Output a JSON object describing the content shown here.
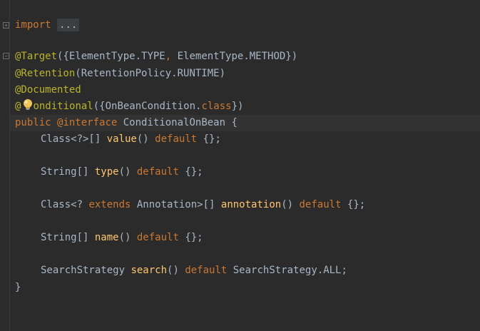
{
  "editor": {
    "lines": {
      "l1_kw": "import",
      "l1_folded": "...",
      "l2_ann": "@Target",
      "l2_rest_open": "({ElementType.TYPE",
      "l2_comma": ",",
      "l2_rest_close": " ElementType.METHOD})",
      "l3_ann": "@Retention",
      "l3_rest": "(RetentionPolicy.RUNTIME)",
      "l4_ann": "@Documented",
      "l5_ann_a": "@",
      "l5_ann_b": "onditional",
      "l5_rest_open": "({OnBeanCondition.",
      "l5_kw": "class",
      "l5_rest_close": "})",
      "l6_kw1": "public",
      "l6_kw2": "@interface",
      "l6_name": "ConditionalOnBean",
      "l6_brace": "{",
      "l7_type": "Class<?>[] ",
      "l7_method": "value",
      "l7_parens": "() ",
      "l7_kw": "default",
      "l7_tail": " {};",
      "l8_type": "String[] ",
      "l8_method": "type",
      "l8_parens": "() ",
      "l8_kw": "default",
      "l8_tail": " {};",
      "l9_type_a": "Class<? ",
      "l9_kw_ext": "extends",
      "l9_type_b": " Annotation>[] ",
      "l9_method": "annotation",
      "l9_parens": "() ",
      "l9_kw": "default",
      "l9_tail": " {};",
      "l10_type": "String[] ",
      "l10_method": "name",
      "l10_parens": "() ",
      "l10_kw": "default",
      "l10_tail": " {};",
      "l11_type": "SearchStrategy ",
      "l11_method": "search",
      "l11_parens": "() ",
      "l11_kw": "default",
      "l11_tail": " SearchStrategy.ALL;",
      "l12_brace": "}"
    },
    "colors": {
      "background": "#2b2b2b",
      "keyword": "#cc7832",
      "annotation": "#bbb529",
      "text": "#a9b7c6",
      "current_line": "#323232"
    },
    "icons": {
      "fold_expand": "plus-fold-icon",
      "fold_collapse": "minus-fold-icon",
      "intention": "lightbulb-icon"
    }
  }
}
